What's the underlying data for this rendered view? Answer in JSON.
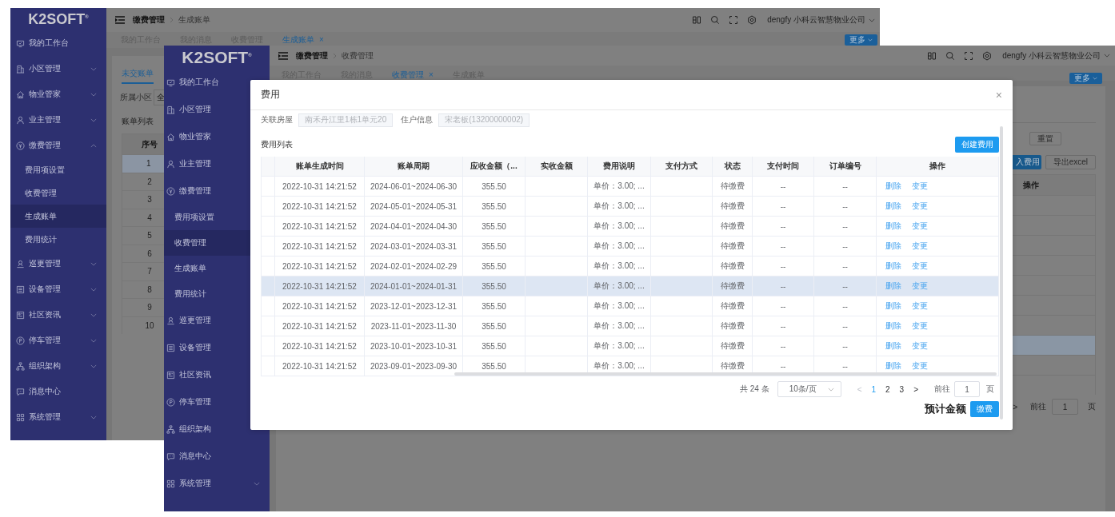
{
  "back_window": {
    "logo": "K2SOFT$^{®}$",
    "sidebar": [
      {
        "label": "我的工作台",
        "selected": false
      },
      {
        "label": "小区管理",
        "selected": false,
        "expanded": false
      },
      {
        "label": "物业管家",
        "selected": false,
        "expanded": false
      },
      {
        "label": "业主管理",
        "selected": false,
        "expanded": false
      },
      {
        "label": "缴费管理",
        "selected": false,
        "expanded": true,
        "children": [
          {
            "label": "费用项设置",
            "selected": false
          },
          {
            "label": "收费管理",
            "selected": false
          },
          {
            "label": "生成账单",
            "selected": true
          },
          {
            "label": "费用统计",
            "selected": false
          }
        ]
      },
      {
        "label": "巡更管理",
        "selected": false,
        "expanded": false
      },
      {
        "label": "设备管理",
        "selected": false,
        "expanded": false
      },
      {
        "label": "社区资讯",
        "selected": false,
        "expanded": false
      },
      {
        "label": "停车管理",
        "selected": false,
        "expanded": false
      },
      {
        "label": "组织架构",
        "selected": false,
        "expanded": false
      },
      {
        "label": "消息中心",
        "selected": false
      },
      {
        "label": "系统管理",
        "selected": false,
        "expanded": false
      }
    ],
    "breadcrumb": [
      "缴费管理",
      "生成账单"
    ],
    "user": "dengfy 小科云智慧物业公司",
    "tabs": [
      {
        "label": "我的工作台",
        "selected": false
      },
      {
        "label": "我的消息",
        "selected": false
      },
      {
        "label": "收费管理",
        "selected": false
      },
      {
        "label": "生成账单",
        "selected": true,
        "close": "×"
      }
    ],
    "more_button": "更多",
    "panel": {
      "tab": "未交账单",
      "filter_label": "所属小区",
      "filter_value": "全",
      "list_title": "账单列表",
      "index_column": "序号",
      "rows": [
        {
          "index": "1",
          "selected": true
        },
        {
          "index": "2",
          "selected": false
        },
        {
          "index": "3",
          "selected": false
        },
        {
          "index": "4",
          "selected": false
        },
        {
          "index": "5",
          "selected": false
        },
        {
          "index": "6",
          "selected": false
        },
        {
          "index": "7",
          "selected": false
        },
        {
          "index": "8",
          "selected": false
        },
        {
          "index": "9",
          "selected": false
        },
        {
          "index": "10",
          "selected": false
        }
      ]
    }
  },
  "front_window": {
    "logo": "K2SOFT$^{®}$",
    "sidebar": [
      {
        "label": "我的工作台",
        "selected": false
      },
      {
        "label": "小区管理",
        "selected": false
      },
      {
        "label": "物业管家",
        "selected": false
      },
      {
        "label": "业主管理",
        "selected": false
      },
      {
        "label": "缴费管理",
        "selected": false,
        "children": [
          {
            "label": "费用项设置",
            "selected": false
          },
          {
            "label": "收费管理",
            "selected": true
          },
          {
            "label": "生成账单",
            "selected": false
          },
          {
            "label": "费用统计",
            "selected": false
          }
        ]
      },
      {
        "label": "巡更管理",
        "selected": false
      },
      {
        "label": "设备管理",
        "selected": false
      },
      {
        "label": "社区资讯",
        "selected": false
      },
      {
        "label": "停车管理",
        "selected": false
      },
      {
        "label": "组织架构",
        "selected": false
      },
      {
        "label": "消息中心",
        "selected": false
      },
      {
        "label": "系统管理",
        "selected": false,
        "expanded": false
      }
    ],
    "breadcrumb": [
      "缴费管理",
      "收费管理"
    ],
    "user": "dengfy 小科云智慧物业公司",
    "tabs": [
      {
        "label": "我的工作台",
        "selected": false
      },
      {
        "label": "我的消息",
        "selected": false
      },
      {
        "label": "收费管理",
        "selected": true,
        "close": "×"
      },
      {
        "label": "生成账单",
        "selected": false
      }
    ],
    "more_button": "更多",
    "panel": {
      "reset_button": "重置",
      "import_button": "入费用",
      "export_button": "导出excel",
      "action_column": "操作",
      "rows": [
        {
          "highlighted": false
        },
        {
          "highlighted": false
        },
        {
          "highlighted": false
        },
        {
          "highlighted": false
        },
        {
          "highlighted": false
        },
        {
          "highlighted": false
        },
        {
          "highlighted": false
        },
        {
          "highlighted": true
        },
        {
          "highlighted": false
        },
        {
          "highlighted": false
        }
      ],
      "pagination": {
        "next": ">",
        "goto": "前往",
        "page": "1",
        "unit": "页"
      }
    }
  },
  "dialog": {
    "title": "费用",
    "close": "×",
    "fields": [
      {
        "label": "关联房屋",
        "value": "南禾丹江里1栋1单元20"
      },
      {
        "label": "住户信息",
        "value": "宋老板(13200000002)"
      }
    ],
    "list_title": "费用列表",
    "create_button": "创建费用",
    "columns": [
      "账单生成时间",
      "账单周期",
      "应收金额（...",
      "实收金额",
      "费用说明",
      "支付方式",
      "状态",
      "支付时间",
      "订单编号",
      "操作"
    ],
    "rows": [
      {
        "created": "2022-10-31 14:21:52",
        "period": "2024-06-01~2024-06-30",
        "amount": "355.50",
        "note": "单价：3.00; ...",
        "status": "待缴费",
        "paid_at": "--",
        "order_no": "--",
        "actions": [
          "删除",
          "变更"
        ],
        "highlighted": false
      },
      {
        "created": "2022-10-31 14:21:52",
        "period": "2024-05-01~2024-05-31",
        "amount": "355.50",
        "note": "单价：3.00; ...",
        "status": "待缴费",
        "paid_at": "--",
        "order_no": "--",
        "actions": [
          "删除",
          "变更"
        ],
        "highlighted": false
      },
      {
        "created": "2022-10-31 14:21:52",
        "period": "2024-04-01~2024-04-30",
        "amount": "355.50",
        "note": "单价：3.00; ...",
        "status": "待缴费",
        "paid_at": "--",
        "order_no": "--",
        "actions": [
          "删除",
          "变更"
        ],
        "highlighted": false
      },
      {
        "created": "2022-10-31 14:21:52",
        "period": "2024-03-01~2024-03-31",
        "amount": "355.50",
        "note": "单价：3.00; ...",
        "status": "待缴费",
        "paid_at": "--",
        "order_no": "--",
        "actions": [
          "删除",
          "变更"
        ],
        "highlighted": false
      },
      {
        "created": "2022-10-31 14:21:52",
        "period": "2024-02-01~2024-02-29",
        "amount": "355.50",
        "note": "单价：3.00; ...",
        "status": "待缴费",
        "paid_at": "--",
        "order_no": "--",
        "actions": [
          "删除",
          "变更"
        ],
        "highlighted": false
      },
      {
        "created": "2022-10-31 14:21:52",
        "period": "2024-01-01~2024-01-31",
        "amount": "355.50",
        "note": "单价：3.00; ...",
        "status": "待缴费",
        "paid_at": "--",
        "order_no": "--",
        "actions": [
          "删除",
          "变更"
        ],
        "highlighted": true
      },
      {
        "created": "2022-10-31 14:21:52",
        "period": "2023-12-01~2023-12-31",
        "amount": "355.50",
        "note": "单价：3.00; ...",
        "status": "待缴费",
        "paid_at": "--",
        "order_no": "--",
        "actions": [
          "删除",
          "变更"
        ],
        "highlighted": false
      },
      {
        "created": "2022-10-31 14:21:52",
        "period": "2023-11-01~2023-11-30",
        "amount": "355.50",
        "note": "单价：3.00; ...",
        "status": "待缴费",
        "paid_at": "--",
        "order_no": "--",
        "actions": [
          "删除",
          "变更"
        ],
        "highlighted": false
      },
      {
        "created": "2022-10-31 14:21:52",
        "period": "2023-10-01~2023-10-31",
        "amount": "355.50",
        "note": "单价：3.00; ...",
        "status": "待缴费",
        "paid_at": "--",
        "order_no": "--",
        "actions": [
          "删除",
          "变更"
        ],
        "highlighted": false
      },
      {
        "created": "2022-10-31 14:21:52",
        "period": "2023-09-01~2023-09-30",
        "amount": "355.50",
        "note": "单价：3.00; ...",
        "status": "待缴费",
        "paid_at": "--",
        "order_no": "--",
        "actions": [
          "删除",
          "变更"
        ],
        "highlighted": false
      }
    ],
    "pagination": {
      "total": "共 24 条",
      "page_size": "10条/页",
      "prev": "<",
      "pages": [
        {
          "label": "1",
          "selected": true
        },
        {
          "label": "2",
          "selected": false
        },
        {
          "label": "3",
          "selected": false
        }
      ],
      "next": ">",
      "goto": "前往",
      "page": "1",
      "unit": "页"
    },
    "estimate_label": "预计金额",
    "pay_button": "缴费"
  }
}
